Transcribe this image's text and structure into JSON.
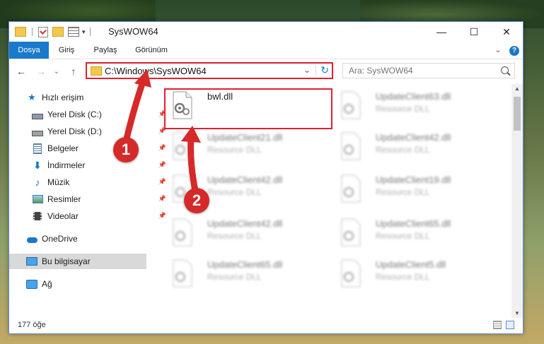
{
  "window": {
    "title": "SysWOW64",
    "controls": {
      "minimize": "—",
      "maximize": "☐",
      "close": "✕"
    }
  },
  "ribbon": {
    "tabs": [
      "Dosya",
      "Giriş",
      "Paylaş",
      "Görünüm"
    ],
    "expand_glyph": "⌄",
    "help_glyph": "?"
  },
  "navigation": {
    "back_glyph": "←",
    "forward_glyph": "→",
    "recent_glyph": "⌄",
    "up_glyph": "↑",
    "address": "C:\\Windows\\SysWOW64",
    "address_dropdown_glyph": "⌄",
    "refresh_glyph": "↻",
    "search_placeholder": "Ara: SysWOW64"
  },
  "sidebar": {
    "items": [
      {
        "label": "Hızlı erişim",
        "icon": "star-icon"
      },
      {
        "label": "Yerel Disk (C:)",
        "icon": "drive-icon",
        "pinned": true
      },
      {
        "label": "Yerel Disk (D:)",
        "icon": "drive-icon",
        "pinned": true
      },
      {
        "label": "Belgeler",
        "icon": "documents-icon",
        "pinned": true
      },
      {
        "label": "İndirmeler",
        "icon": "download-icon",
        "pinned": true
      },
      {
        "label": "Müzik",
        "icon": "music-icon",
        "pinned": true
      },
      {
        "label": "Resimler",
        "icon": "pictures-icon",
        "pinned": true
      },
      {
        "label": "Videolar",
        "icon": "videos-icon",
        "pinned": true
      },
      {
        "label": "OneDrive",
        "icon": "cloud-icon"
      },
      {
        "label": "Bu bilgisayar",
        "icon": "computer-icon",
        "selected": true
      },
      {
        "label": "Ağ",
        "icon": "network-icon"
      }
    ],
    "pin_glyph": "📌"
  },
  "files": [
    {
      "name": "bwl.dll",
      "type": "",
      "highlighted": true
    },
    {
      "name": "UpdateClient63.dll",
      "type": "Resource DLL"
    },
    {
      "name": "UpdateClient21.dll",
      "type": "Resource DLL"
    },
    {
      "name": "UpdateClient42.dll",
      "type": "Resource DLL"
    },
    {
      "name": "UpdateClient42.dll",
      "type": "Resource DLL"
    },
    {
      "name": "UpdateClient19.dll",
      "type": "Resource DLL"
    },
    {
      "name": "UpdateClient42.dll",
      "type": "Resource DLL"
    },
    {
      "name": "UpdateClient65.dll",
      "type": "Resource DLL"
    },
    {
      "name": "UpdateClient65.dll",
      "type": "Resource DLL"
    },
    {
      "name": "UpdateClient5.dll",
      "type": "Resource DLL"
    }
  ],
  "status": {
    "item_count": "177 öğe"
  },
  "annotations": {
    "step1": "1",
    "step2": "2"
  },
  "colors": {
    "accent": "#1979ca",
    "highlight": "#e02030",
    "badge": "#d62a2a"
  }
}
